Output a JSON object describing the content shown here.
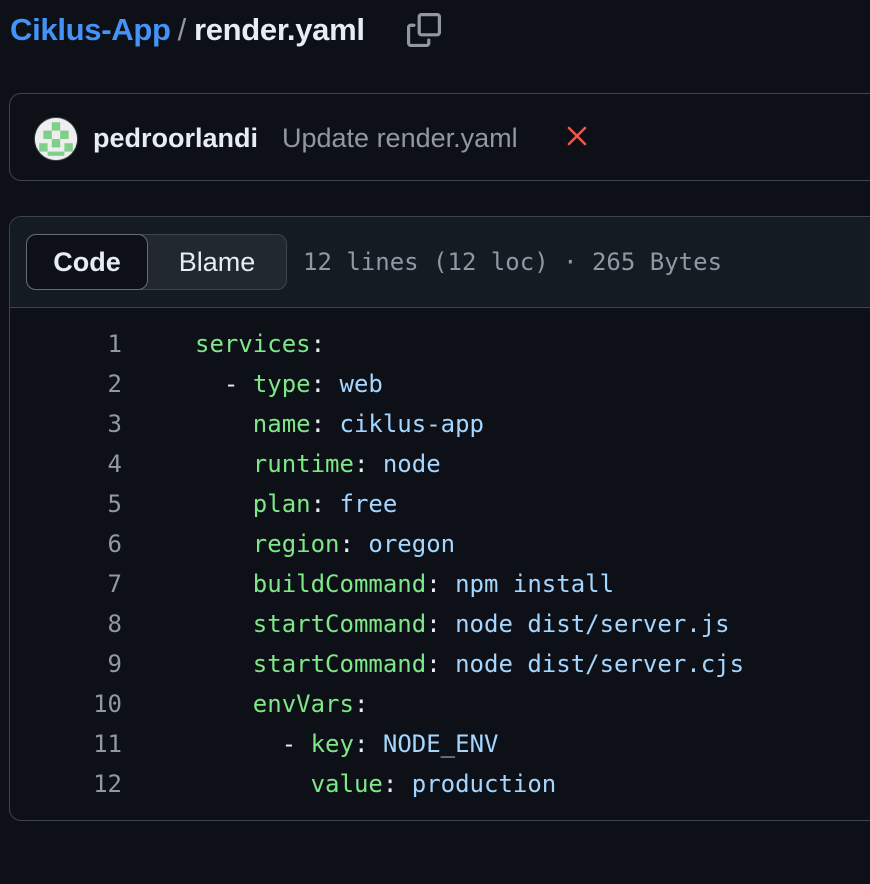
{
  "breadcrumb": {
    "repo": "Ciklus-App",
    "separator": "/",
    "file": "render.yaml"
  },
  "commit": {
    "author": "pedroorlandi",
    "message": "Update render.yaml",
    "status": "failure",
    "status_color": "#f85149"
  },
  "file": {
    "tabs": {
      "code": "Code",
      "blame": "Blame"
    },
    "meta": "12 lines (12 loc) · 265 Bytes"
  },
  "code_lines": [
    {
      "num": "1",
      "indent": "",
      "dash": "",
      "key": "services",
      "colon": ":",
      "value": ""
    },
    {
      "num": "2",
      "indent": "  ",
      "dash": "- ",
      "key": "type",
      "colon": ": ",
      "value": "web"
    },
    {
      "num": "3",
      "indent": "    ",
      "dash": "",
      "key": "name",
      "colon": ": ",
      "value": "ciklus-app"
    },
    {
      "num": "4",
      "indent": "    ",
      "dash": "",
      "key": "runtime",
      "colon": ": ",
      "value": "node"
    },
    {
      "num": "5",
      "indent": "    ",
      "dash": "",
      "key": "plan",
      "colon": ": ",
      "value": "free"
    },
    {
      "num": "6",
      "indent": "    ",
      "dash": "",
      "key": "region",
      "colon": ": ",
      "value": "oregon"
    },
    {
      "num": "7",
      "indent": "    ",
      "dash": "",
      "key": "buildCommand",
      "colon": ": ",
      "value": "npm install"
    },
    {
      "num": "8",
      "indent": "    ",
      "dash": "",
      "key": "startCommand",
      "colon": ": ",
      "value": "node dist/server.js"
    },
    {
      "num": "9",
      "indent": "    ",
      "dash": "",
      "key": "startCommand",
      "colon": ": ",
      "value": "node dist/server.cjs"
    },
    {
      "num": "10",
      "indent": "    ",
      "dash": "",
      "key": "envVars",
      "colon": ":",
      "value": ""
    },
    {
      "num": "11",
      "indent": "      ",
      "dash": "- ",
      "key": "key",
      "colon": ": ",
      "value": "NODE_ENV"
    },
    {
      "num": "12",
      "indent": "        ",
      "dash": "",
      "key": "value",
      "colon": ": ",
      "value": "production"
    }
  ]
}
